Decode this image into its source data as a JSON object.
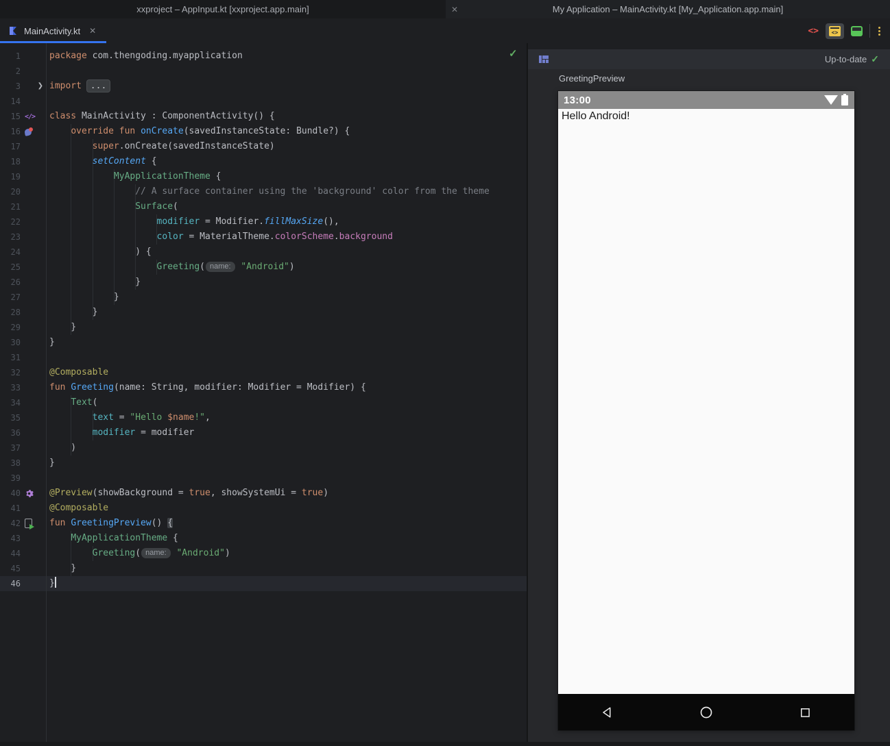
{
  "window": {
    "left_title": "xxproject – AppInput.kt [xxproject.app.main]",
    "right_title": "My Application – MainActivity.kt [My_Application.app.main]",
    "close_glyph": "✕"
  },
  "tabbar": {
    "tab_label": "MainActivity.kt",
    "tab_close_glyph": "✕",
    "code_glyph": "<>",
    "split_glyph": "<>"
  },
  "editor": {
    "inspection_check": "✓",
    "lines": [
      {
        "n": "1",
        "t": [
          [
            "kw",
            "package"
          ],
          [
            "pl",
            " com.thengoding.myapplication"
          ]
        ]
      },
      {
        "n": "2",
        "t": []
      },
      {
        "n": "3",
        "g": "fold-arrow",
        "t": [
          [
            "kw",
            "import"
          ],
          [
            "pl",
            " "
          ],
          [
            "fold",
            "..."
          ]
        ]
      },
      {
        "n": "14",
        "t": []
      },
      {
        "n": "15",
        "g": "composable-icon",
        "t": [
          [
            "kw",
            "class"
          ],
          [
            "pl",
            " MainActivity : ComponentActivity() {"
          ]
        ]
      },
      {
        "n": "16",
        "g": "override-icon",
        "t": [
          [
            "pl",
            "    "
          ],
          [
            "kw",
            "override"
          ],
          [
            "pl",
            " "
          ],
          [
            "kw",
            "fun"
          ],
          [
            "pl",
            " "
          ],
          [
            "fn",
            "onCreate"
          ],
          [
            "pl",
            "(savedInstanceState: Bundle?) {"
          ]
        ]
      },
      {
        "n": "17",
        "t": [
          [
            "pl",
            "        "
          ],
          [
            "kw",
            "super"
          ],
          [
            "pl",
            ".onCreate(savedInstanceState)"
          ]
        ]
      },
      {
        "n": "18",
        "t": [
          [
            "pl",
            "        "
          ],
          [
            "fni",
            "setContent"
          ],
          [
            "pl",
            " {"
          ]
        ]
      },
      {
        "n": "19",
        "t": [
          [
            "pl",
            "            "
          ],
          [
            "cp",
            "MyApplicationTheme"
          ],
          [
            "pl",
            " {"
          ]
        ]
      },
      {
        "n": "20",
        "t": [
          [
            "cm",
            "                // A surface container using the 'background' color from the theme"
          ]
        ]
      },
      {
        "n": "21",
        "t": [
          [
            "pl",
            "                "
          ],
          [
            "cp",
            "Surface"
          ],
          [
            "pl",
            "("
          ]
        ]
      },
      {
        "n": "22",
        "t": [
          [
            "pl",
            "                    "
          ],
          [
            "na",
            "modifier"
          ],
          [
            "pl",
            " = Modifier."
          ],
          [
            "fni",
            "fillMaxSize"
          ],
          [
            "pl",
            "(),"
          ]
        ]
      },
      {
        "n": "23",
        "t": [
          [
            "pl",
            "                    "
          ],
          [
            "na",
            "color"
          ],
          [
            "pl",
            " = MaterialTheme."
          ],
          [
            "pr",
            "colorScheme"
          ],
          [
            "pl",
            "."
          ],
          [
            "pr",
            "background"
          ]
        ]
      },
      {
        "n": "24",
        "t": [
          [
            "pl",
            "                ) {"
          ]
        ]
      },
      {
        "n": "25",
        "t": [
          [
            "pl",
            "                    "
          ],
          [
            "cp",
            "Greeting"
          ],
          [
            "pl",
            "("
          ],
          [
            "hint",
            "name:"
          ],
          [
            "st",
            " \"Android\""
          ],
          [
            "pl",
            ")"
          ]
        ]
      },
      {
        "n": "26",
        "t": [
          [
            "pl",
            "                }"
          ]
        ]
      },
      {
        "n": "27",
        "t": [
          [
            "pl",
            "            }"
          ]
        ]
      },
      {
        "n": "28",
        "t": [
          [
            "pl",
            "        }"
          ]
        ]
      },
      {
        "n": "29",
        "t": [
          [
            "pl",
            "    }"
          ]
        ]
      },
      {
        "n": "30",
        "t": [
          [
            "pl",
            "}"
          ]
        ]
      },
      {
        "n": "31",
        "t": []
      },
      {
        "n": "32",
        "t": [
          [
            "an",
            "@Composable"
          ]
        ]
      },
      {
        "n": "33",
        "t": [
          [
            "kw",
            "fun"
          ],
          [
            "pl",
            " "
          ],
          [
            "fn",
            "Greeting"
          ],
          [
            "pl",
            "(name: String, modifier: Modifier = Modifier) {"
          ]
        ]
      },
      {
        "n": "34",
        "t": [
          [
            "pl",
            "    "
          ],
          [
            "cp",
            "Text"
          ],
          [
            "pl",
            "("
          ]
        ]
      },
      {
        "n": "35",
        "t": [
          [
            "pl",
            "        "
          ],
          [
            "na",
            "text"
          ],
          [
            "pl",
            " = "
          ],
          [
            "st",
            "\"Hello "
          ],
          [
            "stv",
            "$name"
          ],
          [
            "st",
            "!\""
          ],
          [
            "pl",
            ","
          ]
        ]
      },
      {
        "n": "36",
        "t": [
          [
            "pl",
            "        "
          ],
          [
            "na",
            "modifier"
          ],
          [
            "pl",
            " = modifier"
          ]
        ]
      },
      {
        "n": "37",
        "t": [
          [
            "pl",
            "    )"
          ]
        ]
      },
      {
        "n": "38",
        "t": [
          [
            "pl",
            "}"
          ]
        ]
      },
      {
        "n": "39",
        "t": []
      },
      {
        "n": "40",
        "g": "gear-icon",
        "t": [
          [
            "an",
            "@Preview"
          ],
          [
            "pl",
            "(showBackground = "
          ],
          [
            "kw",
            "true"
          ],
          [
            "pl",
            ", showSystemUi = "
          ],
          [
            "kw",
            "true"
          ],
          [
            "pl",
            ")"
          ]
        ]
      },
      {
        "n": "41",
        "t": [
          [
            "an",
            "@Composable"
          ]
        ]
      },
      {
        "n": "42",
        "g": "run-preview-icon",
        "t": [
          [
            "kw",
            "fun"
          ],
          [
            "pl",
            " "
          ],
          [
            "fn",
            "GreetingPreview"
          ],
          [
            "pl",
            "() "
          ],
          [
            "bh",
            "{"
          ]
        ]
      },
      {
        "n": "43",
        "t": [
          [
            "pl",
            "    "
          ],
          [
            "cp",
            "MyApplicationTheme"
          ],
          [
            "pl",
            " {"
          ]
        ]
      },
      {
        "n": "44",
        "t": [
          [
            "pl",
            "        "
          ],
          [
            "cp",
            "Greeting"
          ],
          [
            "pl",
            "("
          ],
          [
            "hint",
            "name:"
          ],
          [
            "st",
            " \"Android\""
          ],
          [
            "pl",
            ")"
          ]
        ]
      },
      {
        "n": "45",
        "t": [
          [
            "pl",
            "    }"
          ]
        ]
      },
      {
        "n": "46",
        "caret": true,
        "t": [
          [
            "pl",
            "}"
          ]
        ]
      }
    ]
  },
  "preview": {
    "status_label": "Up-to-date",
    "status_check": "✓",
    "preview_name": "GreetingPreview",
    "phone": {
      "time": "13:00",
      "content_text": "Hello Android!"
    }
  },
  "colors": {
    "accent_blue": "#3574f0",
    "status_green": "#5fb363",
    "keyword_orange": "#cf8e6d",
    "string_green": "#6aab73",
    "function_blue": "#56a8f5",
    "status_bar_gray": "#8a8a8a"
  }
}
